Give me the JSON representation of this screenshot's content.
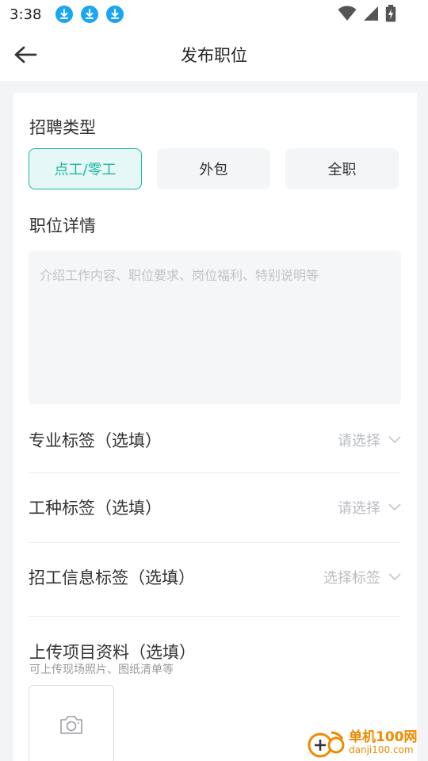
{
  "status_bar": {
    "time": "3:38",
    "notifications": [
      "download-icon",
      "download-icon",
      "download-icon"
    ],
    "indicators": [
      "wifi-icon",
      "signal-icon",
      "battery-charging-icon"
    ]
  },
  "header": {
    "back_icon": "arrow-left-icon",
    "title": "发布职位"
  },
  "form": {
    "recruit_type": {
      "label": "招聘类型",
      "options": [
        "点工/零工",
        "外包",
        "全职"
      ],
      "selected": "点工/零工"
    },
    "job_detail": {
      "label": "职位详情",
      "placeholder": "介绍工作内容、职位要求、岗位福利、特别说明等"
    },
    "pro_tag": {
      "label": "专业标签（选填）",
      "value": "请选择"
    },
    "work_tag": {
      "label": "工种标签（选填）",
      "value": "请选择"
    },
    "info_tag": {
      "label": "招工信息标签（选填）",
      "value": "选择标签"
    },
    "upload": {
      "label": "上传项目资料（选填）",
      "hint": "可上传现场照片、图纸清单等",
      "icon": "camera-icon"
    }
  },
  "watermark": {
    "title": "单机100网",
    "url": "danji100.com"
  },
  "colors": {
    "accent": "#1fb5a4",
    "accent_bg": "#e6f8f6",
    "download_icon": "#1aa6f0",
    "watermark": "#f08a00"
  }
}
